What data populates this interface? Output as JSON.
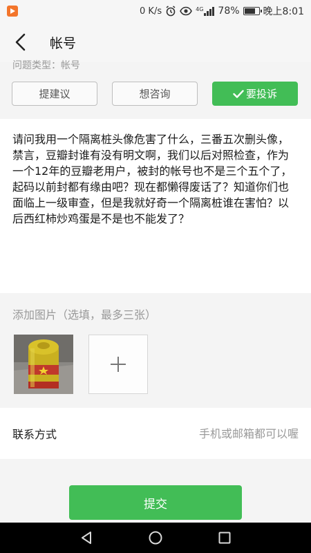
{
  "status_bar": {
    "network_speed": "0 K/s",
    "signal_tag": "4G",
    "battery": "78%",
    "battery_level": 0.78,
    "time": "晚上8:01"
  },
  "header": {
    "title": "帐号"
  },
  "partial_text": "问题类型：帐号",
  "choices": [
    {
      "label": "提建议",
      "active": false
    },
    {
      "label": "想咨询",
      "active": false
    },
    {
      "label": "要投诉",
      "active": true
    }
  ],
  "complaint_text": "请问我用一个隔离桩头像危害了什么，三番五次删头像，禁言，豆瓣封谁有没有明文啊，我们以后对照检查，作为一个12年的豆瓣老用户，被封的帐号也不是三个五个了，起码以前封都有缘由吧？现在都懒得废话了？知道你们也面临上一级审查，但是我就好奇一个隔离桩谁在害怕？以后西红柿炒鸡蛋是不是也不能发了？",
  "images": {
    "label": "添加图片（选填，最多三张）"
  },
  "contact": {
    "label": "联系方式",
    "placeholder": "手机或邮箱都可以喔",
    "value": ""
  },
  "submit_label": "提交",
  "colors": {
    "accent": "#42bd56",
    "notification_icon": "#f3752b"
  }
}
